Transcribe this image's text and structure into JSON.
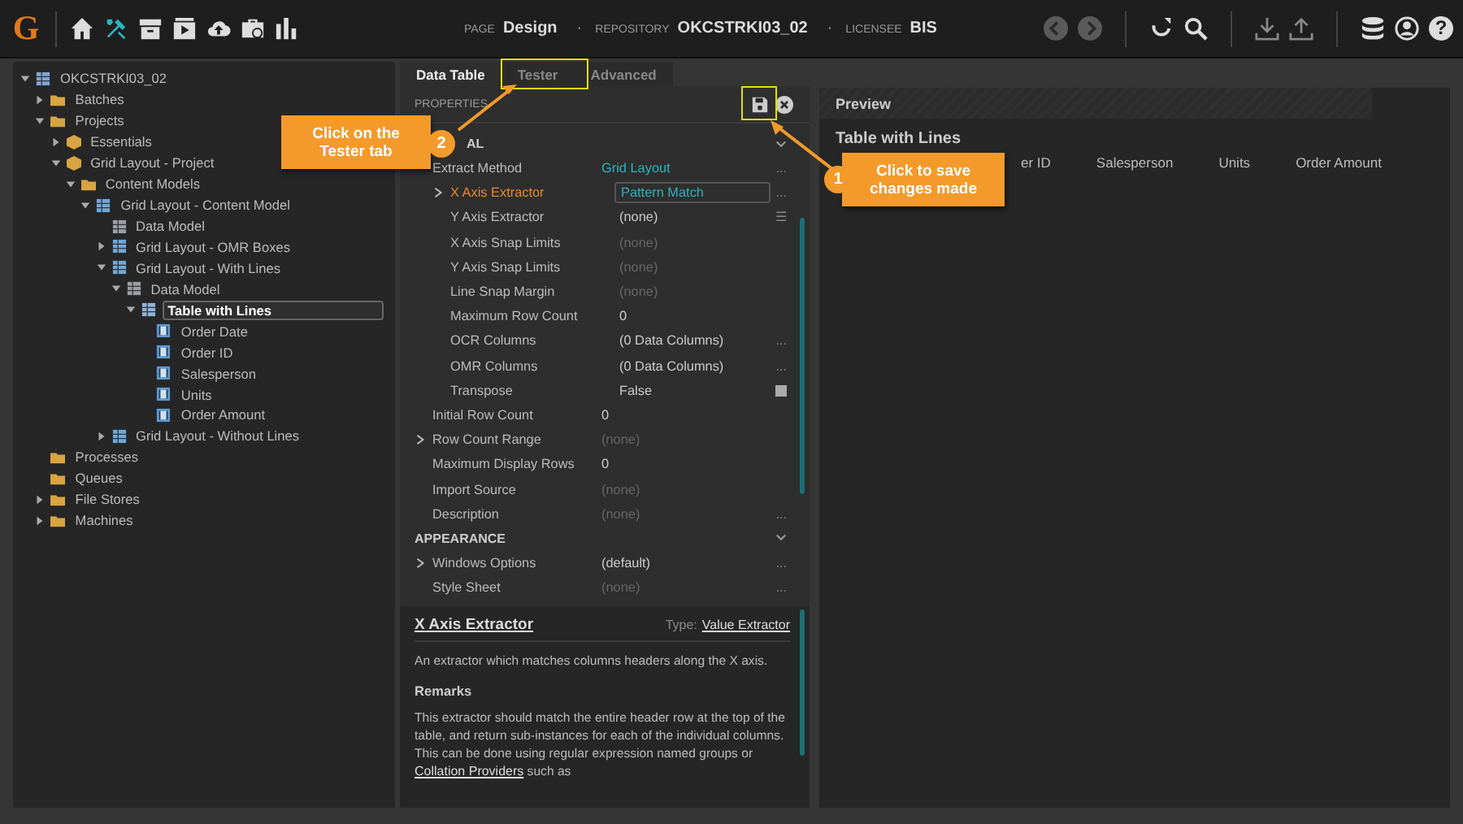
{
  "topbar": {
    "logo": "G",
    "nav": [
      {
        "kind": "home",
        "selected": false
      },
      {
        "kind": "tools",
        "selected": true
      },
      {
        "kind": "archive",
        "selected": false
      },
      {
        "kind": "play",
        "selected": false
      },
      {
        "kind": "cloud",
        "selected": false
      },
      {
        "kind": "briefcase",
        "selected": false
      },
      {
        "kind": "chart",
        "selected": false
      }
    ],
    "info": [
      {
        "label": "PAGE",
        "value": "Design"
      },
      {
        "label": "REPOSITORY",
        "value": "OKCSTRKI03_02"
      },
      {
        "label": "LICENSEE",
        "value": "BIS"
      }
    ],
    "separator": "·",
    "help": "?"
  },
  "tree": [
    {
      "label": "OKCSTRKI03_02",
      "kind": "repo",
      "expanded": true,
      "selected": false,
      "children": [
        {
          "label": "Batches",
          "kind": "folder",
          "expanded": false,
          "selected": false
        },
        {
          "label": "Projects",
          "kind": "folder",
          "expanded": true,
          "selected": false,
          "children": [
            {
              "label": "Essentials",
              "kind": "project",
              "expanded": false,
              "selected": false
            },
            {
              "label": "Grid Layout - Project",
              "kind": "project",
              "expanded": true,
              "selected": false,
              "children": [
                {
                  "label": "Content Models",
                  "kind": "folder",
                  "expanded": true,
                  "selected": false,
                  "children": [
                    {
                      "label": "Grid Layout - Content Model",
                      "kind": "model",
                      "expanded": true,
                      "selected": false,
                      "children": [
                        {
                          "label": "Data Model",
                          "kind": "datamodel",
                          "selected": false
                        },
                        {
                          "label": "Grid Layout - OMR Boxes",
                          "kind": "layout",
                          "expanded": false,
                          "selected": false
                        },
                        {
                          "label": "Grid Layout - With Lines",
                          "kind": "layout",
                          "expanded": true,
                          "selected": false,
                          "children": [
                            {
                              "label": "Data Model",
                              "kind": "datamodel",
                              "expanded": true,
                              "selected": false,
                              "children": [
                                {
                                  "label": "Table with Lines",
                                  "kind": "table",
                                  "expanded": true,
                                  "selected": true,
                                  "children": [
                                    {
                                      "label": "Order Date",
                                      "kind": "field",
                                      "selected": false
                                    },
                                    {
                                      "label": "Order ID",
                                      "kind": "field",
                                      "selected": false
                                    },
                                    {
                                      "label": "Salesperson",
                                      "kind": "field",
                                      "selected": false
                                    },
                                    {
                                      "label": "Units",
                                      "kind": "field",
                                      "selected": false
                                    },
                                    {
                                      "label": "Order Amount",
                                      "kind": "field",
                                      "selected": false
                                    }
                                  ]
                                }
                              ]
                            }
                          ]
                        },
                        {
                          "label": "Grid Layout - Without Lines",
                          "kind": "layout",
                          "expanded": false,
                          "selected": false
                        }
                      ]
                    }
                  ]
                }
              ]
            }
          ]
        },
        {
          "label": "Processes",
          "kind": "folder",
          "selected": false
        },
        {
          "label": "Queues",
          "kind": "folder",
          "selected": false
        },
        {
          "label": "File Stores",
          "kind": "folder",
          "expanded": false,
          "selected": false
        },
        {
          "label": "Machines",
          "kind": "folder",
          "expanded": false,
          "selected": false
        }
      ]
    }
  ],
  "tabs": [
    {
      "label": "Data Table",
      "selected": true
    },
    {
      "label": "Tester",
      "selected": false
    },
    {
      "label": "Advanced",
      "selected": false
    }
  ],
  "properties": {
    "title": "PROPERTIES",
    "sections": [
      {
        "title": "AL",
        "rows": [
          {
            "name": "Extract Method",
            "value": "Grid Layout",
            "kind": "link",
            "selected": false,
            "action": "...",
            "children": [
              {
                "name": "X Axis Extractor",
                "value": "Pattern Match",
                "kind": "link",
                "expanded": false,
                "selected": true,
                "action": "..."
              },
              {
                "name": "Y Axis Extractor",
                "value": "(none)",
                "kind": "normal",
                "selected": false,
                "action": "☰"
              },
              {
                "name": "X Axis Snap Limits",
                "value": "(none)",
                "kind": "muted",
                "selected": false
              },
              {
                "name": "Y Axis Snap Limits",
                "value": "(none)",
                "kind": "muted",
                "selected": false
              },
              {
                "name": "Line Snap Margin",
                "value": "(none)",
                "kind": "muted",
                "selected": false
              },
              {
                "name": "Maximum Row Count",
                "value": "0",
                "kind": "normal",
                "selected": false
              },
              {
                "name": "OCR Columns",
                "value": "(0 Data Columns)",
                "kind": "normal",
                "selected": false,
                "action": "..."
              },
              {
                "name": "OMR Columns",
                "value": "(0 Data Columns)",
                "kind": "normal",
                "selected": false,
                "action": "..."
              },
              {
                "name": "Transpose",
                "value": "False",
                "kind": "normal",
                "selected": false,
                "checked": false
              }
            ]
          },
          {
            "name": "Initial Row Count",
            "value": "0",
            "kind": "normal",
            "selected": false
          },
          {
            "name": "Row Count Range",
            "value": "(none)",
            "kind": "muted",
            "expanded": false,
            "selected": false
          },
          {
            "name": "Maximum Display Rows",
            "value": "0",
            "kind": "normal",
            "selected": false
          },
          {
            "name": "Import Source",
            "value": "(none)",
            "kind": "muted",
            "selected": false
          },
          {
            "name": "Description",
            "value": "(none)",
            "kind": "muted",
            "selected": false,
            "action": "..."
          }
        ]
      },
      {
        "title": "APPEARANCE",
        "rows": [
          {
            "name": "Windows Options",
            "value": "(default)",
            "kind": "normal",
            "expanded": false,
            "selected": false,
            "action": "..."
          },
          {
            "name": "Style Sheet",
            "value": "(none)",
            "kind": "muted",
            "selected": false,
            "action": "..."
          }
        ]
      }
    ]
  },
  "help": {
    "title": "X Axis Extractor",
    "type_label": "Type:",
    "type_value": "Value Extractor",
    "description": "An extractor which matches columns headers along the X axis.",
    "remarks_title": "Remarks",
    "remarks_before": "This extractor should match the entire header row at the top of the table, and return sub-instances for each of the individual columns. This can be done using regular expression named groups or ",
    "remarks_link": "Collation Providers",
    "remarks_after": " such as"
  },
  "preview": {
    "title": "Preview",
    "table_title": "Table with Lines",
    "columns": [
      "er ID",
      "Salesperson",
      "Units",
      "Order Amount"
    ]
  },
  "callouts": [
    {
      "number": "2",
      "text": "Click on the Tester tab"
    },
    {
      "number": "1",
      "text": "Click to save changes made"
    }
  ]
}
